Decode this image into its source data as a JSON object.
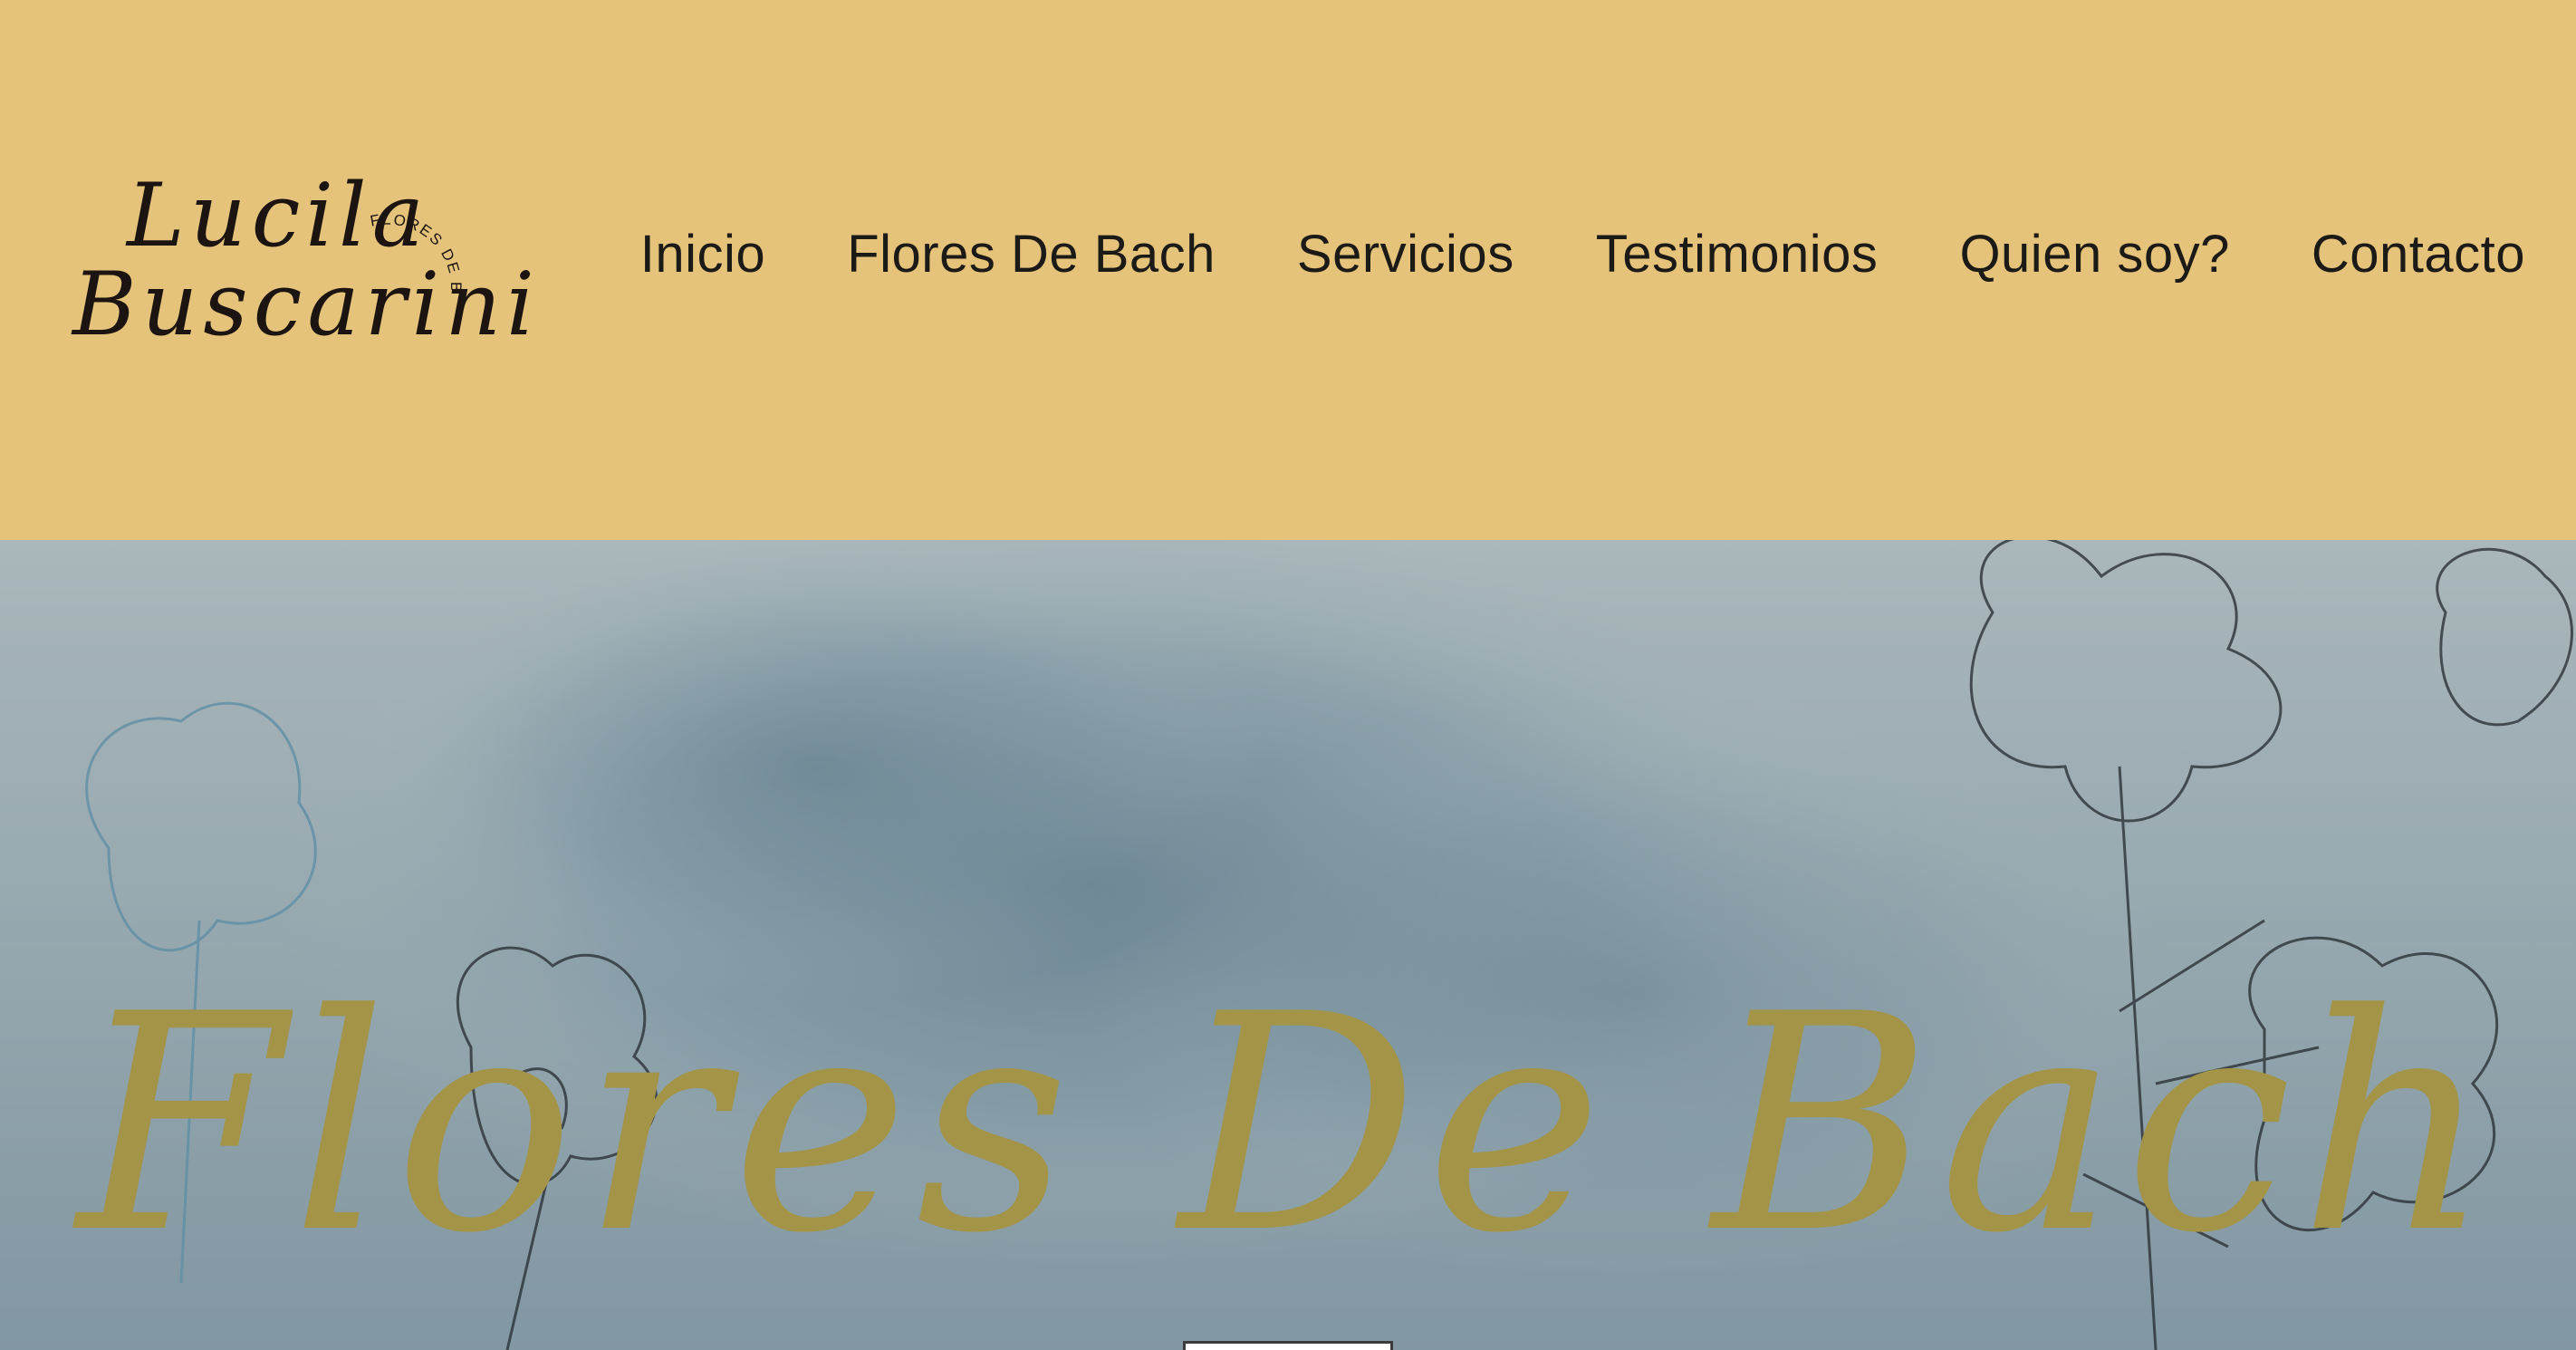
{
  "brand": {
    "name_line1": "Lucila",
    "name_line2": "Buscarini",
    "tagline": "FLORES DE BACH"
  },
  "nav": {
    "items": [
      {
        "label": "Inicio"
      },
      {
        "label": "Flores De Bach"
      },
      {
        "label": "Servicios"
      },
      {
        "label": "Testimonios"
      },
      {
        "label": "Quien soy?"
      },
      {
        "label": "Contacto"
      }
    ]
  },
  "hero": {
    "title": "Flores De Bach"
  },
  "colors": {
    "header_bg": "#e5c37a",
    "hero_title": "#a39447",
    "nav_text": "#1c1a16"
  }
}
